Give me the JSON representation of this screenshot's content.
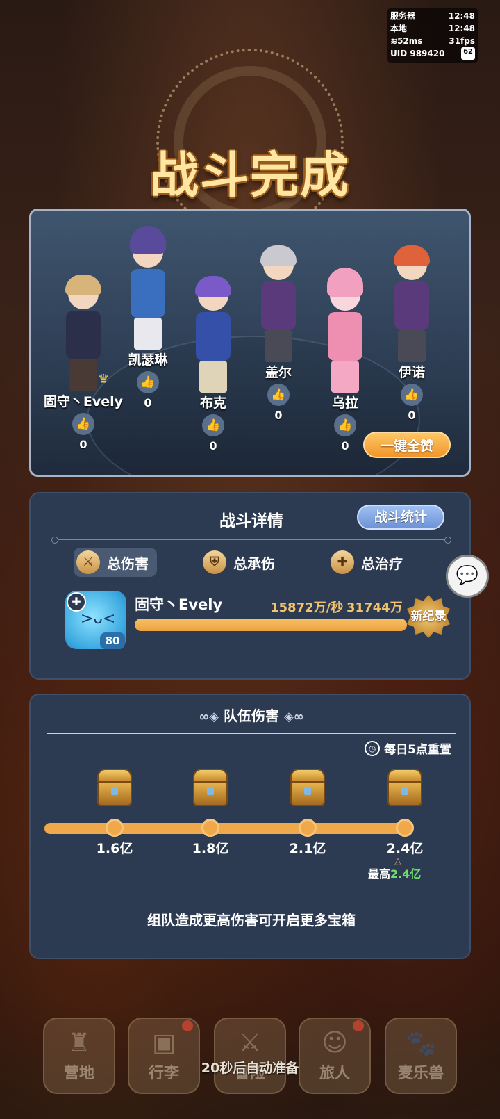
{
  "status": {
    "server_label": "服务器",
    "server_time": "12:48",
    "local_label": "本地",
    "local_time": "12:48",
    "ping": "52ms",
    "fps": "31fps",
    "uid_label": "UID",
    "uid": "989420",
    "battery": "62"
  },
  "title": "战斗完成",
  "party": {
    "members": [
      {
        "name": "固守丶Evely",
        "likes": "0",
        "is_leader": true
      },
      {
        "name": "凯瑟琳",
        "likes": "0",
        "is_leader": false
      },
      {
        "name": "布克",
        "likes": "0",
        "is_leader": false
      },
      {
        "name": "盖尔",
        "likes": "0",
        "is_leader": false
      },
      {
        "name": "乌拉",
        "likes": "0",
        "is_leader": false
      },
      {
        "name": "伊诺",
        "likes": "0",
        "is_leader": false
      }
    ],
    "like_all_label": "一键全赞",
    "like_icon": "thumbs-up-icon",
    "leader_icon": "crown-icon"
  },
  "battle_detail": {
    "title": "战斗详情",
    "stats_button": "战斗统计",
    "tabs": [
      {
        "label": "总伤害",
        "icon": "sword-icon",
        "active": true
      },
      {
        "label": "总承伤",
        "icon": "shield-icon",
        "active": false
      },
      {
        "label": "总治疗",
        "icon": "heal-cross-icon",
        "active": false
      }
    ],
    "player": {
      "name": "固守丶Evely",
      "level": "80",
      "dps": "15872万/秒",
      "total": "31744万",
      "bar_fill": 1.0,
      "record_badge": "新纪录"
    }
  },
  "team_damage": {
    "title": "队伍伤害",
    "reset_text": "每日5点重置",
    "milestones": [
      "1.6亿",
      "1.8亿",
      "2.1亿",
      "2.4亿"
    ],
    "progress": 1.0,
    "best_label": "最高",
    "best_value": "2.4亿",
    "hint": "组队造成更高伤害可开启更多宝箱"
  },
  "nav": {
    "items": [
      {
        "label": "营地",
        "icon": "castle-icon",
        "badge": false
      },
      {
        "label": "行李",
        "icon": "backpack-icon",
        "badge": true
      },
      {
        "label": "冒险",
        "icon": "crossed-swords-icon",
        "badge": false
      },
      {
        "label": "旅人",
        "icon": "traveler-icon",
        "badge": true
      },
      {
        "label": "麦乐兽",
        "icon": "pet-icon",
        "badge": false
      }
    ],
    "auto_ready": "20秒后自动准备"
  },
  "colors": {
    "accent": "#f0a94a",
    "panel": "#2d3b52",
    "title": "#ffe6a3",
    "best_value": "#6de06a"
  }
}
